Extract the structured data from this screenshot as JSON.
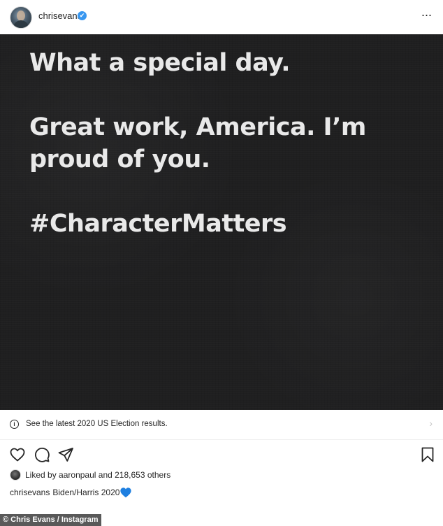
{
  "header": {
    "username": "chrisevans",
    "verified_symbol": "✔",
    "avatar_icon": "profile-avatar",
    "more_icon": "more-options-icon",
    "more_label": "···"
  },
  "post_image": {
    "lines": [
      "What a special day.",
      "Great work, America. I’m",
      "proud of you.",
      "#CharacterMatters"
    ],
    "background_color": "#1f1f20",
    "text_color": "#e9e9e9"
  },
  "election_bar": {
    "info_icon": "info-icon",
    "info_symbol": "i",
    "text": "See the latest 2020 US Election results.",
    "chevron_icon": "chevron-right-icon",
    "chevron_symbol": "›"
  },
  "actions": {
    "like_icon": "heart-icon",
    "comment_icon": "comment-icon",
    "share_icon": "share-icon",
    "save_icon": "bookmark-icon"
  },
  "likes": {
    "prefix": "Liked by",
    "user": "aaronpaul",
    "suffix": "and 218,653 others"
  },
  "caption": {
    "user": "chrisevans",
    "text": "Biden/Harris 2020",
    "emoji": "blue-heart-icon",
    "emoji_color": "#1e7fe0"
  },
  "watermark": {
    "text": "© Chris Evans / Instagram"
  }
}
